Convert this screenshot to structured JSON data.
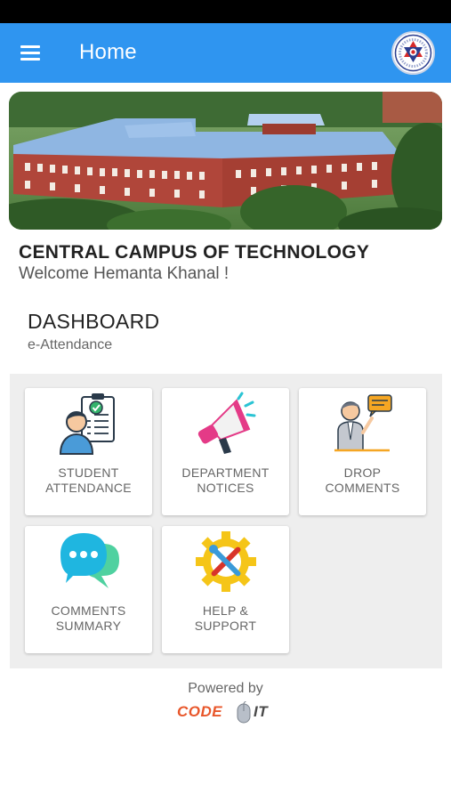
{
  "app_bar": {
    "title": "Home",
    "menu_icon": "hamburger-menu-icon",
    "logo_icon": "university-emblem-icon"
  },
  "hero": {
    "image": "campus-building-photo"
  },
  "campus": {
    "name": "CENTRAL CAMPUS OF TECHNOLOGY",
    "welcome": "Welcome Hemanta Khanal !"
  },
  "dashboard": {
    "title": "DASHBOARD",
    "subtitle": "e-Attendance"
  },
  "tiles": [
    {
      "label": "STUDENT\nATTENDANCE",
      "icon": "student-attendance-icon"
    },
    {
      "label": "DEPARTMENT\nNOTICES",
      "icon": "megaphone-icon"
    },
    {
      "label": "DROP\nCOMMENTS",
      "icon": "presenter-comment-icon"
    },
    {
      "label": "COMMENTS\nSUMMARY",
      "icon": "chat-bubbles-icon"
    },
    {
      "label": "HELP &\nSUPPORT",
      "icon": "gear-tools-icon"
    }
  ],
  "footer": {
    "powered_by": "Powered by",
    "brand_left": "CODE",
    "brand_right": "IT",
    "brand_icon": "mouse-icon"
  },
  "colors": {
    "app_bar": "#2f95f0",
    "status_bar": "#000000",
    "brand_orange": "#e8562a",
    "brand_gray": "#4a4a4a"
  }
}
